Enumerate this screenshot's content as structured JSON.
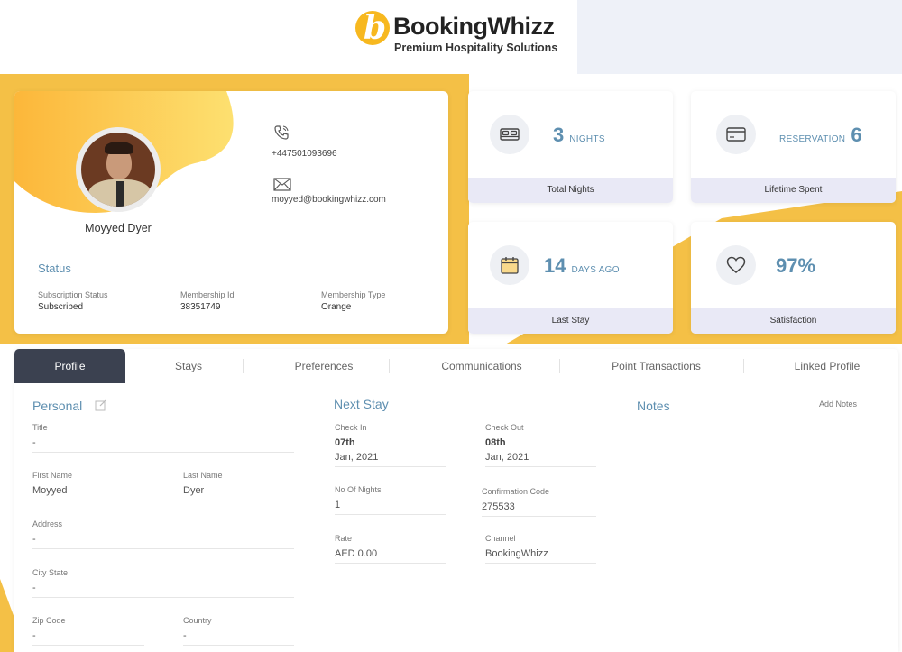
{
  "brand": {
    "initial": "b",
    "name": "BookingWhizz",
    "tagline": "Premium Hospitality Solutions",
    "accent": "#f7b81f",
    "highlight": "#5e8fb0",
    "dark_tab": "#3b4150"
  },
  "profile": {
    "name": "Moyyed Dyer",
    "phone": "+447501093696",
    "email": "moyyed@bookingwhizz.com"
  },
  "status": {
    "title": "Status",
    "subscription_label": "Subscription Status",
    "subscription_value": "Subscribed",
    "membership_id_label": "Membership Id",
    "membership_id_value": "38351749",
    "membership_type_label": "Membership Type",
    "membership_type_value": "Orange"
  },
  "stats": {
    "total_nights": {
      "value": "3",
      "unit": "NIGHTS",
      "footer": "Total Nights",
      "icon": "bed-icon"
    },
    "lifetime_spent": {
      "prefix": "RESERVATION",
      "value": "6",
      "footer": "Lifetime Spent",
      "icon": "credit-card-icon"
    },
    "last_stay": {
      "value": "14",
      "unit": "DAYS AGO",
      "footer": "Last Stay",
      "icon": "calendar-icon"
    },
    "satisfaction": {
      "value": "97%",
      "footer": "Satisfaction",
      "icon": "heart-icon"
    }
  },
  "tabs": [
    "Profile",
    "Stays",
    "Preferences",
    "Communications",
    "Point Transactions",
    "Linked Profile"
  ],
  "personal": {
    "title": "Personal",
    "title_label": "Title",
    "title_value": "-",
    "first_name_label": "First Name",
    "first_name_value": "Moyyed",
    "last_name_label": "Last Name",
    "last_name_value": "Dyer",
    "address_label": "Address",
    "address_value": "-",
    "city_label": "City State",
    "city_value": "-",
    "zip_label": "Zip Code",
    "zip_value": "-",
    "country_label": "Country",
    "country_value": "-"
  },
  "next_stay": {
    "title": "Next Stay",
    "check_in_label": "Check In",
    "check_in_day": "07th",
    "check_in_month": "Jan, 2021",
    "check_out_label": "Check Out",
    "check_out_day": "08th",
    "check_out_month": "Jan, 2021",
    "nights_label": "No Of Nights",
    "nights_value": "1",
    "confirmation_label": "Confirmation Code",
    "confirmation_value": "275533",
    "rate_label": "Rate",
    "rate_value": "AED 0.00",
    "channel_label": "Channel",
    "channel_value": "BookingWhizz"
  },
  "notes": {
    "title": "Notes",
    "add_label": "Add Notes"
  }
}
